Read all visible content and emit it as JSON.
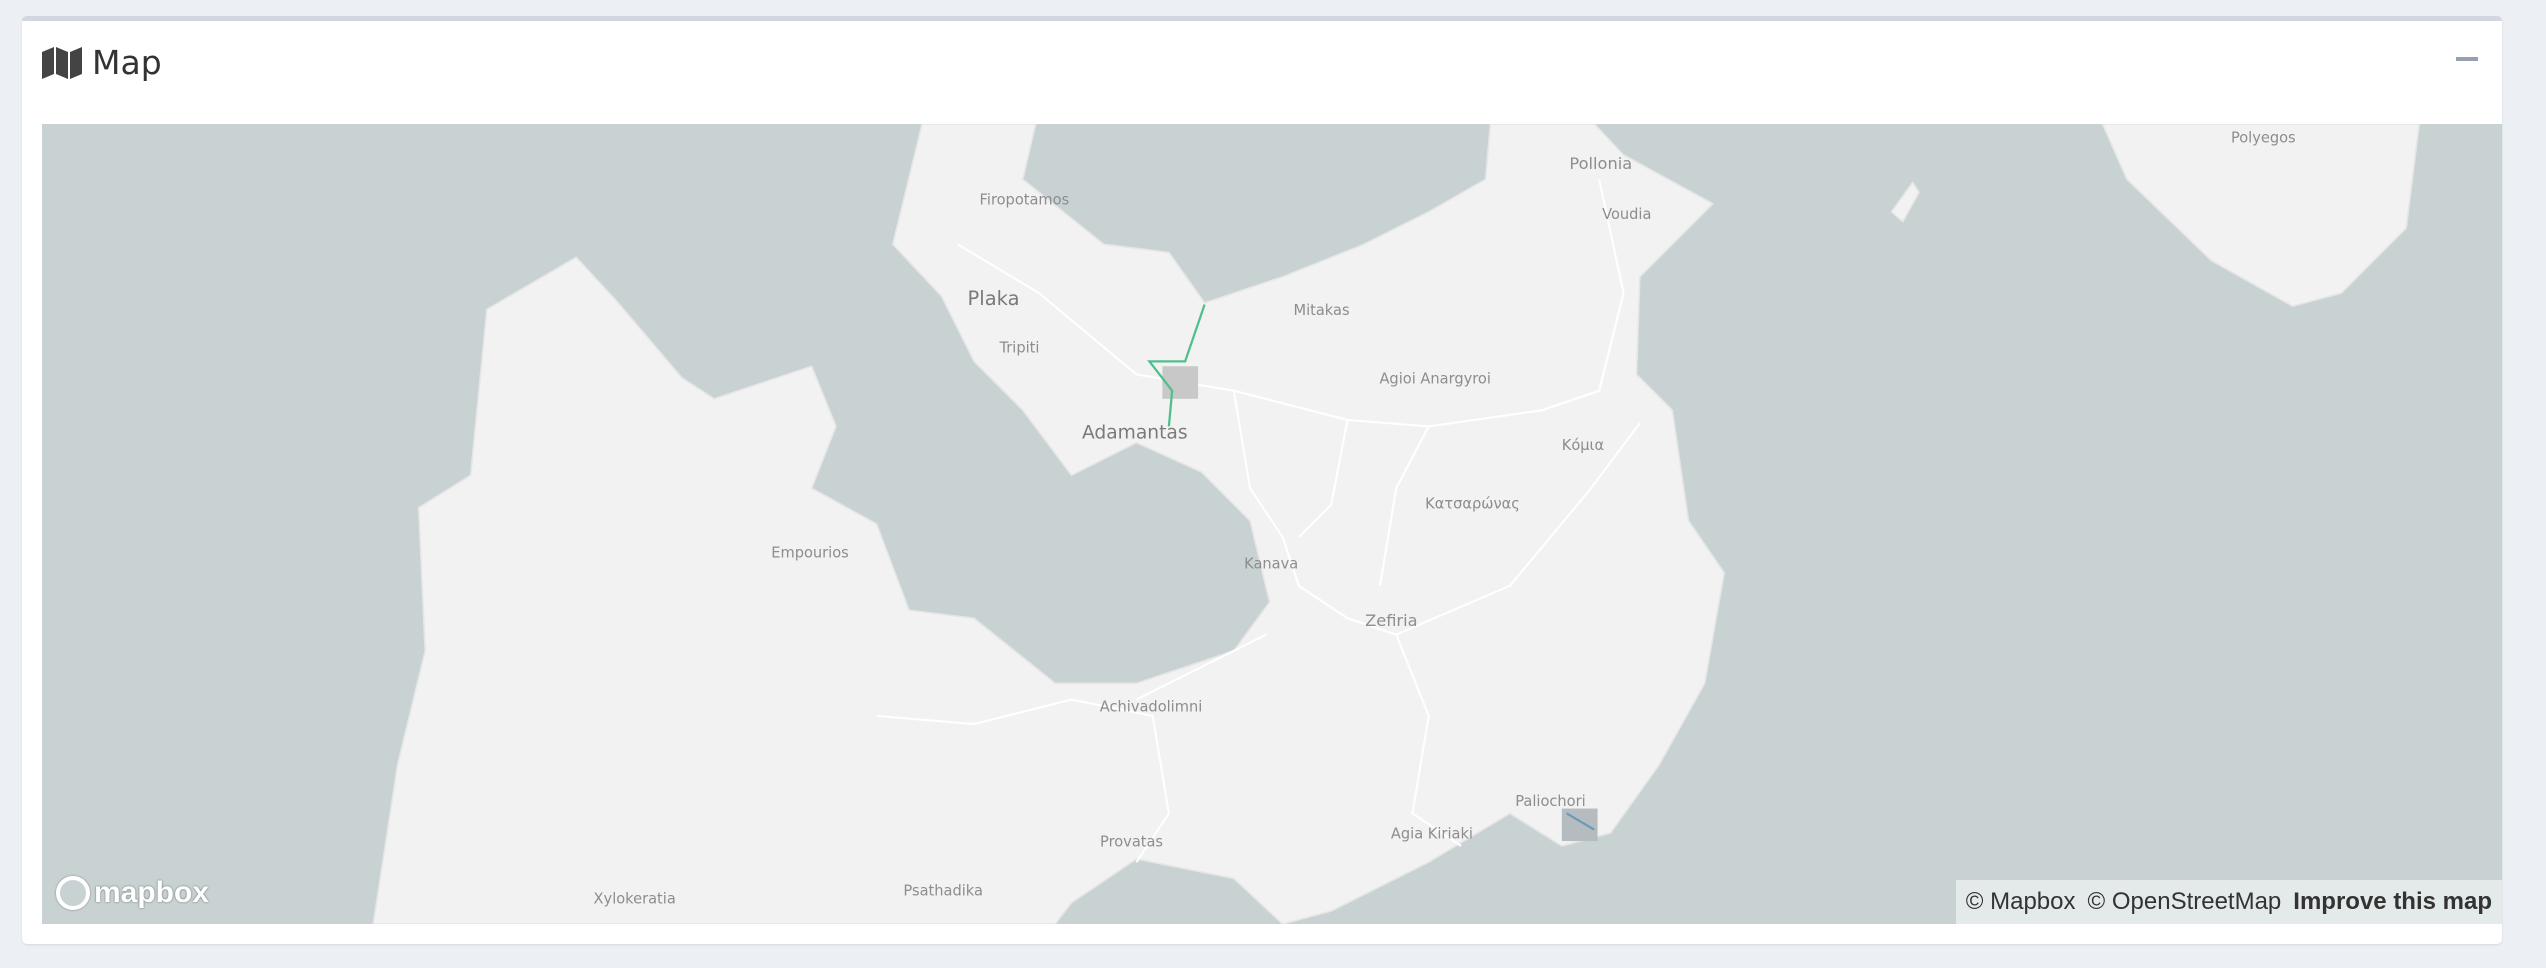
{
  "card": {
    "title": "Map",
    "icon": "map-icon",
    "minimize_icon": "minus-icon"
  },
  "map": {
    "labels": {
      "polyegos": "Polyegos",
      "pollonia": "Pollonia",
      "voudia": "Voudia",
      "firopotamos": "Firopotamos",
      "plaka": "Plaka",
      "mitakas": "Mitakas",
      "tripiti": "Tripiti",
      "agioi_anargyroi": "Agioi Anargyroi",
      "adamantas": "Adamantas",
      "komia": "Κόμια",
      "katsaronas": "Κατσαρώνας",
      "empourios": "Empourios",
      "kanava": "Kanava",
      "zefiria": "Zefiria",
      "achivadolimni": "Achivadolimni",
      "paliochori": "Paliochori",
      "agia_kiriaki": "Agia Kiriaki",
      "provatas": "Provatas",
      "psathadika": "Psathadika",
      "xylokeratia": "Xylokeratia"
    },
    "route_color": "#4fc08d",
    "logo": "mapbox",
    "attribution": {
      "mapbox": "© Mapbox",
      "osm": "© OpenStreetMap",
      "improve": "Improve this map"
    }
  }
}
